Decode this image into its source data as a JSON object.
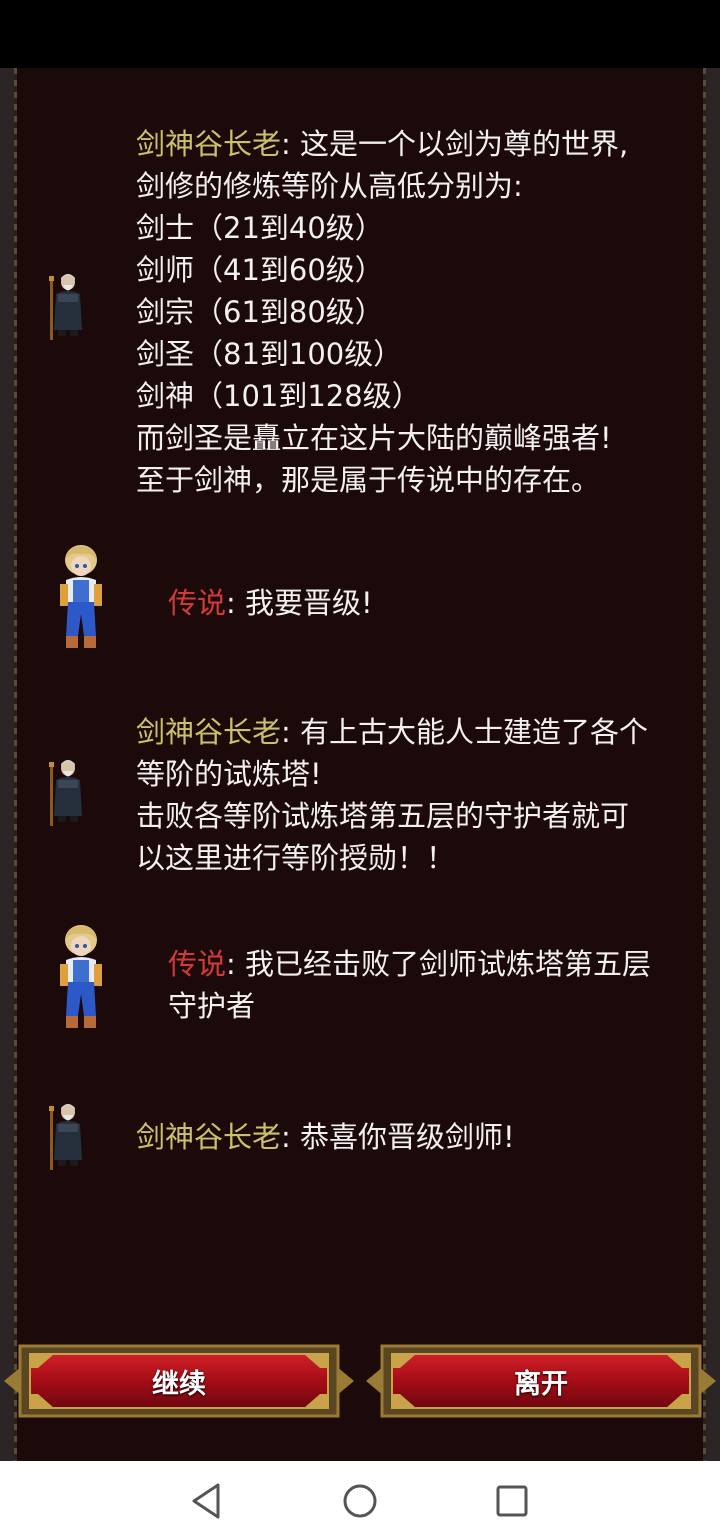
{
  "dialog": [
    {
      "speaker": "剑神谷长老",
      "speaker_type": "elder",
      "lines": [
        "这是一个以剑为尊的世界,",
        "剑修的修炼等阶从高低分别为:",
        "剑士（21到40级）",
        "剑师（41到60级）",
        "剑宗（61到80级）",
        "剑圣（81到100级）",
        "剑神（101到128级）",
        "而剑圣是矗立在这片大陆的巅峰强者!",
        "至于剑神，那是属于传说中的存在。"
      ]
    },
    {
      "speaker": "传说",
      "speaker_type": "player",
      "lines": [
        "我要晋级!"
      ]
    },
    {
      "speaker": "剑神谷长老",
      "speaker_type": "elder",
      "lines": [
        "有上古大能人士建造了各个",
        "等阶的试炼塔!",
        "击败各等阶试炼塔第五层的守护者就可",
        "以这里进行等阶授勋！！"
      ]
    },
    {
      "speaker": "传说",
      "speaker_type": "player",
      "lines": [
        "我已经击败了剑师试炼塔第五层",
        "守护者"
      ]
    },
    {
      "speaker": "剑神谷长老",
      "speaker_type": "elder",
      "lines": [
        "恭喜你晋级剑师!"
      ]
    }
  ],
  "separator": ": ",
  "buttons": {
    "continue_label": "继续",
    "leave_label": "离开"
  },
  "colors": {
    "elder_name": "#c9c26a",
    "player_name": "#d23a3a",
    "text": "#f2f0f0",
    "panel_bg": "#1c0909",
    "button_red": "#b5101a",
    "button_gold": "#9a7b35"
  },
  "icons": {
    "elder": "elder-avatar-icon",
    "player": "player-avatar-icon",
    "nav_back": "back-triangle-icon",
    "nav_home": "home-circle-icon",
    "nav_recent": "recent-square-icon"
  }
}
